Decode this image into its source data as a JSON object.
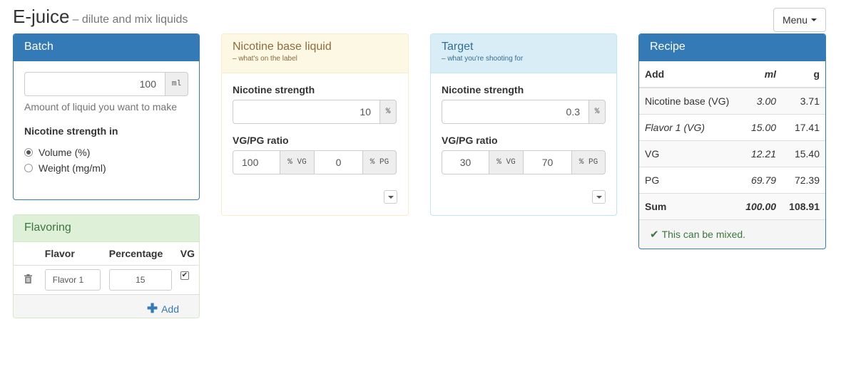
{
  "header": {
    "title": "E-juice",
    "subtitle": "– dilute and mix liquids",
    "menu_label": "Menu"
  },
  "batch": {
    "title": "Batch",
    "amount_value": "100",
    "amount_unit": "ml",
    "amount_help": "Amount of liquid you want to make",
    "strength_label": "Nicotine strength in",
    "options": [
      {
        "label": "Volume (%)",
        "selected": true
      },
      {
        "label": "Weight (mg/ml)",
        "selected": false
      }
    ]
  },
  "nicotine_base": {
    "title": "Nicotine base liquid",
    "subtitle": "– what's on the label",
    "strength_label": "Nicotine strength",
    "strength_value": "10",
    "strength_unit": "%",
    "ratio_label": "VG/PG ratio",
    "vg_value": "100",
    "vg_unit": "% VG",
    "pg_value": "0",
    "pg_unit": "% PG"
  },
  "target": {
    "title": "Target",
    "subtitle": "– what you're shooting for",
    "strength_label": "Nicotine strength",
    "strength_value": "0.3",
    "strength_unit": "%",
    "ratio_label": "VG/PG ratio",
    "vg_value": "30",
    "vg_unit": "% VG",
    "pg_value": "70",
    "pg_unit": "% PG"
  },
  "recipe": {
    "title": "Recipe",
    "columns": {
      "add": "Add",
      "ml": "ml",
      "g": "g"
    },
    "rows": [
      {
        "name": "Nicotine base (VG)",
        "ml": "3.00",
        "g": "3.71"
      },
      {
        "name": "Flavor 1 (VG)",
        "ml": "15.00",
        "g": "17.41"
      },
      {
        "name": "VG",
        "ml": "12.21",
        "g": "15.40"
      },
      {
        "name": "PG",
        "ml": "69.79",
        "g": "72.39"
      }
    ],
    "sum": {
      "name": "Sum",
      "ml": "100.00",
      "g": "108.91"
    },
    "status": "This can be mixed."
  },
  "flavoring": {
    "title": "Flavoring",
    "columns": {
      "flavor": "Flavor",
      "percentage": "Percentage",
      "vg": "VG"
    },
    "rows": [
      {
        "flavor": "Flavor 1",
        "percentage": "15",
        "vg": true
      }
    ],
    "add_label": "Add"
  },
  "colors": {
    "primary": "#337ab7",
    "warning_bg": "#fcf8e3",
    "info_bg": "#d9edf7",
    "success_bg": "#dff0d8",
    "ok_text": "#3c763d"
  }
}
